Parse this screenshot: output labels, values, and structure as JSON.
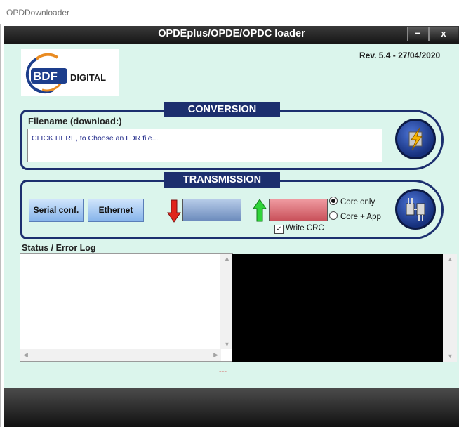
{
  "window": {
    "outer_title": "OPDDownloader",
    "title": "OPDEplus/OPDE/OPDC loader",
    "minimize_label": "–",
    "close_label": "x"
  },
  "header": {
    "logo_text": "BDF DIGITAL",
    "revision": "Rev. 5.4 - 27/04/2020"
  },
  "conversion": {
    "section_label": "CONVERSION",
    "filename_label": "Filename (download:)",
    "file_prompt": "CLICK HERE, to Choose an LDR file..."
  },
  "transmission": {
    "section_label": "TRANSMISSION",
    "serial_button": "Serial conf.",
    "ethernet_button": "Ethernet",
    "radio_options": [
      {
        "label": "Core only",
        "selected": true
      },
      {
        "label": "Core + App",
        "selected": false
      }
    ],
    "write_crc_label": "Write CRC",
    "write_crc_checked": true
  },
  "log": {
    "label": "Status / Error Log",
    "status_text": "---"
  },
  "colors": {
    "client_bg": "#dbf5ec",
    "navy": "#1c2f6e",
    "download_arrow": "#e0251b",
    "upload_arrow": "#2fd43a"
  }
}
